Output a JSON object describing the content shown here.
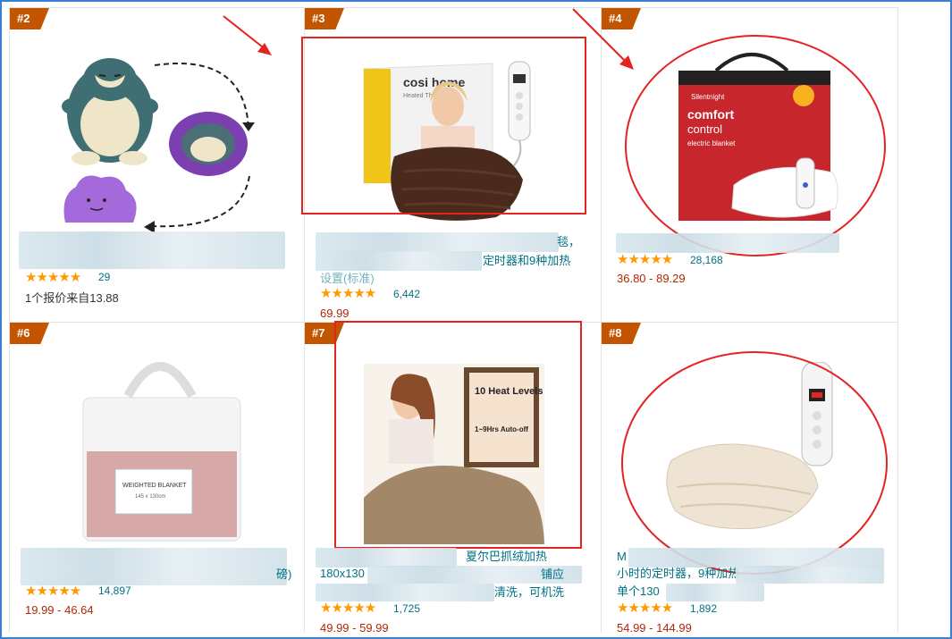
{
  "products": [
    {
      "rank": "#2",
      "rating": "★★★★★",
      "reviews": "29",
      "offer": "1个报价来自13.88",
      "price": ""
    },
    {
      "rank": "#3",
      "rating": "★★★★★",
      "reviews": "6,442",
      "title_tail_1": "毯，",
      "title_tail_2": "定时器和9种加热",
      "title_line_3": "设置(标准)",
      "price": "69.99",
      "img_brand": "cosi home",
      "img_sub": "Heated Throw"
    },
    {
      "rank": "#4",
      "rating": "★★★★★",
      "reviews": "28,168",
      "price": "36.80 - 89.29",
      "img_brand": "Silentnight",
      "img_line1": "comfort",
      "img_line2": "control",
      "img_line3": "electric blanket"
    },
    {
      "rank": "#6",
      "rating": "★★★★★",
      "reviews": "14,897",
      "price": "19.99 - 46.64",
      "img_label": "WEIGHTED BLANKET",
      "img_label_sub": "145 x 130cm",
      "title_tail": "磅)"
    },
    {
      "rank": "#7",
      "rating": "★★★★★",
      "reviews": "1,725",
      "price": "49.99 - 59.99",
      "title_line_1": "夏尔巴抓绒加热",
      "title_line_2": "180x130",
      "title_tail_2": "铺应",
      "title_tail_3": "清洗，可机洗",
      "img_badge_1": "10 Heat Levels",
      "img_badge_2": "1~9Hrs Auto-off"
    },
    {
      "rank": "#8",
      "rating": "★★★★★",
      "reviews": "1,892",
      "price": "54.99 - 144.99",
      "title_line_1": "M",
      "title_line_2": "小时的定时器，9种加热",
      "title_line_3": "单个130"
    }
  ],
  "icons": [
    "annotation-arrow-icon",
    "star-rating-icon"
  ],
  "colors": {
    "rank_badge": "#c45500",
    "annotation": "#e52320",
    "link": "#007185",
    "price": "#b12704",
    "star": "#ff9900"
  }
}
